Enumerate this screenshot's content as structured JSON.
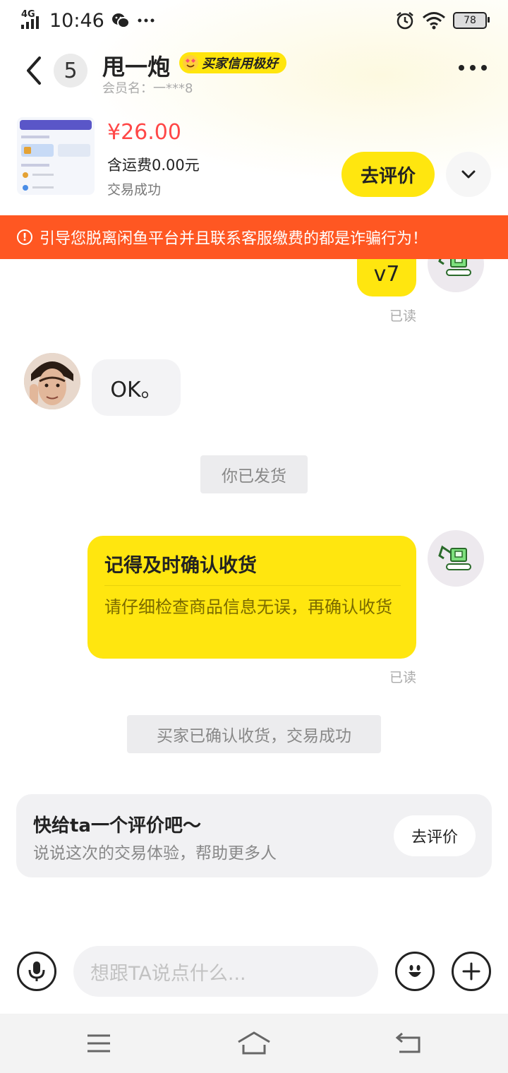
{
  "status_bar": {
    "network": "4G",
    "time": "10:46",
    "extra_icons": [
      "wechat-icon",
      "more-dots-icon"
    ],
    "right_icons": [
      "alarm-icon",
      "wifi-icon"
    ],
    "battery": "78"
  },
  "header": {
    "unread_count": "5",
    "username": "甩一炮",
    "credit_badge": "买家信用极好",
    "member_name": "会员名：一***8"
  },
  "product": {
    "price": "¥26.00",
    "shipping": "含运费0.00元",
    "status": "交易成功",
    "rate_button": "去评价"
  },
  "warning": {
    "text": "引导您脱离闲鱼平台并且联系客服缴费的都是诈骗行为！"
  },
  "messages": [
    {
      "side": "me",
      "text": "v7",
      "read": "已读"
    },
    {
      "side": "other",
      "text": "OK。"
    },
    {
      "side": "system",
      "text": "你已发货"
    },
    {
      "side": "me",
      "card_title": "记得及时确认收货",
      "card_body": "请仔细检查商品信息无误，再确认收货",
      "read": "已读"
    },
    {
      "side": "system",
      "text": "买家已确认收货，交易成功"
    }
  ],
  "review_card": {
    "title": "快给ta一个评价吧～",
    "subtitle": "说说这次的交易体验，帮助更多人",
    "button": "去评价"
  },
  "input_bar": {
    "placeholder": "想跟TA说点什么..."
  },
  "colors": {
    "accent_yellow": "#ffe60f",
    "warning_orange": "#ff5722",
    "price_red": "#ff4747"
  }
}
